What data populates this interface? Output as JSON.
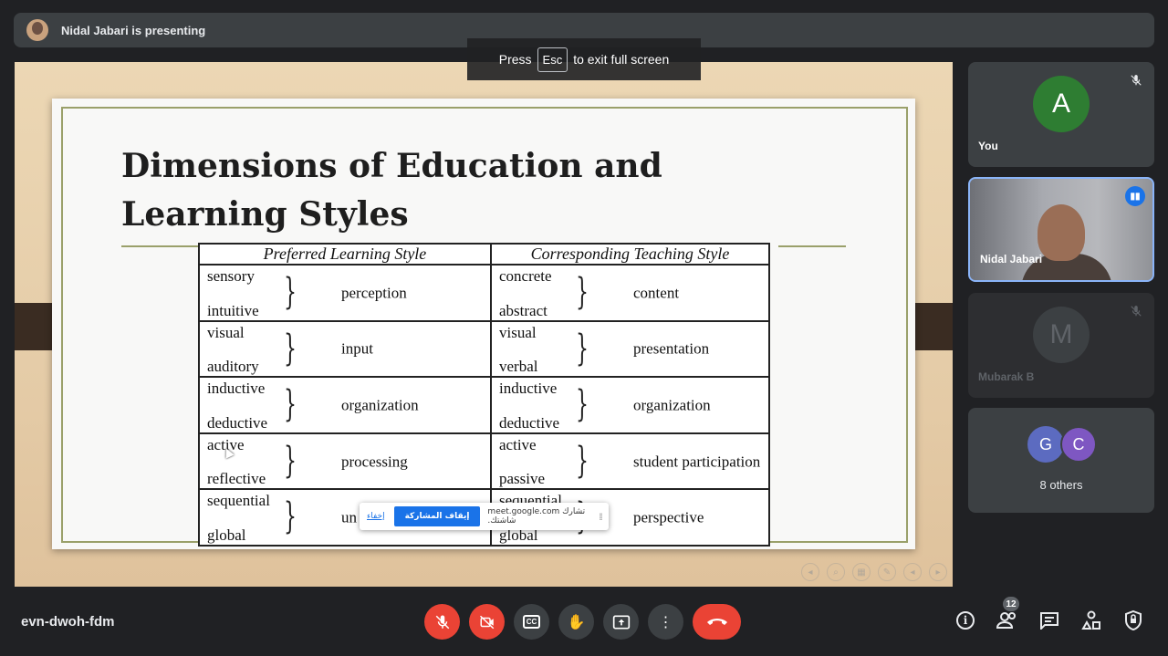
{
  "presenting": {
    "text": "Nidal Jabari is presenting"
  },
  "fullscreen_toast": {
    "press": "Press",
    "key": "Esc",
    "suffix": "to exit full screen"
  },
  "slide": {
    "title": "Dimensions of Education and Learning Styles",
    "table": {
      "headers": [
        "Preferred Learning Style",
        "Corresponding Teaching Style"
      ],
      "rows": [
        {
          "left_top": "sensory",
          "left_bottom": "intuitive",
          "left_label": "perception",
          "right_top": "concrete",
          "right_bottom": "abstract",
          "right_label": "content"
        },
        {
          "left_top": "visual",
          "left_bottom": "auditory",
          "left_label": "input",
          "right_top": "visual",
          "right_bottom": "verbal",
          "right_label": "presentation"
        },
        {
          "left_top": "inductive",
          "left_bottom": "deductive",
          "left_label": "organization",
          "right_top": "inductive",
          "right_bottom": "deductive",
          "right_label": "organization"
        },
        {
          "left_top": "active",
          "left_bottom": "reflective",
          "left_label": "processing",
          "right_top": "active",
          "right_bottom": "passive",
          "right_label": "student participation"
        },
        {
          "left_top": "sequential",
          "left_bottom": "global",
          "left_label": "un",
          "right_top": "sequential",
          "right_bottom": "global",
          "right_label": "perspective"
        }
      ]
    },
    "brace_glyph": "}"
  },
  "share_popup": {
    "hide": "إخفاء",
    "stop": "إيقاف المشاركة",
    "message": "تشارك meet.google.com شاشتك.",
    "drag": "⁞⁞"
  },
  "participants": {
    "you": {
      "initial": "A",
      "name": "You",
      "avatar_color": "#2e7d32"
    },
    "presenter": {
      "name": "Nidal Jabari"
    },
    "mubarak": {
      "initial": "M",
      "name": "Mubarak B"
    },
    "others": {
      "initials": [
        "G",
        "C"
      ],
      "label": "8 others"
    }
  },
  "bottom_bar": {
    "meeting_code": "evn-dwoh-fdm",
    "people_count": "12",
    "cc_label": "CC"
  },
  "icons": {
    "mic_off": "mic-off-icon",
    "camera_off": "camera-off-icon",
    "captions": "captions-icon",
    "raise_hand": "raise-hand-icon",
    "present": "present-screen-icon",
    "more": "more-options-icon",
    "end_call": "end-call-icon",
    "info": "info-icon",
    "people": "people-icon",
    "chat": "chat-icon",
    "activities": "activities-icon",
    "host_controls": "host-controls-icon"
  },
  "colors": {
    "accent": "#1a73e8",
    "danger": "#ea4335",
    "background": "#202124",
    "surface": "#3c4043"
  }
}
